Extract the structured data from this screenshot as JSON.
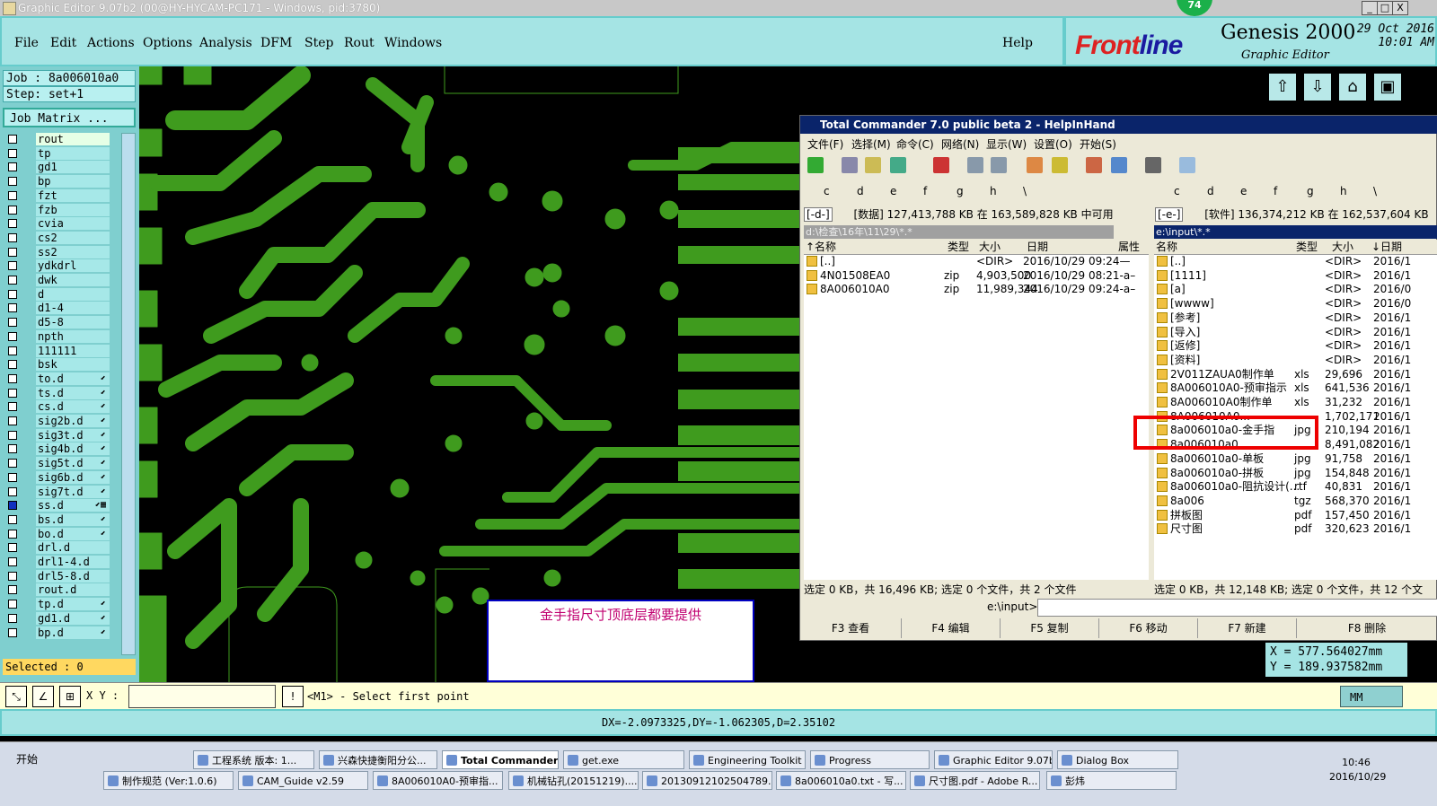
{
  "window": {
    "title": "Graphic Editor 9.07b2 (00@HY-HYCAM-PC171 - Windows, pid:3780)",
    "badge": "74",
    "controls": [
      "_",
      "□",
      "X"
    ]
  },
  "menubar": {
    "items": [
      "File",
      "Edit",
      "Actions",
      "Options",
      "Analysis",
      "DFM",
      "Step",
      "Rout",
      "Windows"
    ],
    "help": "Help"
  },
  "brand": {
    "logo_a": "Front",
    "logo_b": "line",
    "product": "Genesis 2000",
    "subtitle": "Graphic Editor",
    "date": "29 Oct 2016",
    "time": "10:01 AM"
  },
  "job": {
    "job_line": "Job : 8a006010a0",
    "step_line": "Step: set+1",
    "matrix_button": "Job Matrix ..."
  },
  "layers": [
    {
      "name": "rout",
      "mark": ""
    },
    {
      "name": "tp",
      "mark": ""
    },
    {
      "name": "gd1",
      "mark": ""
    },
    {
      "name": "bp",
      "mark": ""
    },
    {
      "name": "fzt",
      "mark": ""
    },
    {
      "name": "fzb",
      "mark": ""
    },
    {
      "name": "cvia",
      "mark": ""
    },
    {
      "name": "cs2",
      "mark": ""
    },
    {
      "name": "ss2",
      "mark": ""
    },
    {
      "name": "ydkdrl",
      "mark": ""
    },
    {
      "name": "dwk",
      "mark": ""
    },
    {
      "name": "d",
      "mark": ""
    },
    {
      "name": "d1-4",
      "mark": ""
    },
    {
      "name": "d5-8",
      "mark": ""
    },
    {
      "name": "npth",
      "mark": ""
    },
    {
      "name": "111111",
      "mark": ""
    },
    {
      "name": "bsk",
      "mark": ""
    },
    {
      "name": "to.d",
      "mark": "⬋"
    },
    {
      "name": "ts.d",
      "mark": "⬋"
    },
    {
      "name": "cs.d",
      "mark": "⬋"
    },
    {
      "name": "sig2b.d",
      "mark": "⬋"
    },
    {
      "name": "sig3t.d",
      "mark": "⬋"
    },
    {
      "name": "sig4b.d",
      "mark": "⬋"
    },
    {
      "name": "sig5t.d",
      "mark": "⬋"
    },
    {
      "name": "sig6b.d",
      "mark": "⬋"
    },
    {
      "name": "sig7t.d",
      "mark": "⬋"
    },
    {
      "name": "ss.d",
      "mark": "⬋▦"
    },
    {
      "name": "bs.d",
      "mark": "⬋"
    },
    {
      "name": "bo.d",
      "mark": "⬋"
    },
    {
      "name": "drl.d",
      "mark": ""
    },
    {
      "name": "drl1-4.d",
      "mark": ""
    },
    {
      "name": "drl5-8.d",
      "mark": ""
    },
    {
      "name": "rout.d",
      "mark": ""
    },
    {
      "name": "tp.d",
      "mark": "⬋"
    },
    {
      "name": "gd1.d",
      "mark": "⬋"
    },
    {
      "name": "bp.d",
      "mark": "⬋"
    }
  ],
  "selected_text": "Selected : 0",
  "note": "金手指尺寸顶底层都要提供",
  "coords": {
    "x": "X =  577.564027mm",
    "y": "Y =  189.937582mm"
  },
  "bottombar": {
    "xy_label": "X Y :",
    "xy_value": "",
    "prompt": "<M1> - Select first point",
    "unit": "MM"
  },
  "measure": "DX=-2.0973325,DY=-1.062305,D=2.35102",
  "tc": {
    "title": "Total Commander 7.0 public beta 2 - HelpInHand",
    "menu": [
      "文件(F)",
      "选择(M)",
      "命令(C)",
      "网络(N)",
      "显示(W)",
      "设置(O)",
      "开始(S)"
    ],
    "drives_left": [
      "c",
      "d",
      "e",
      "f",
      "g",
      "h",
      "\\"
    ],
    "drives_right": [
      "c",
      "d",
      "e",
      "f",
      "g",
      "h",
      "\\"
    ],
    "left": {
      "drive": "[-d-]",
      "info": "[数据]  127,413,788 KB 在 163,589,828 KB 中可用",
      "path": "d:\\检查\\16年\\11\\29\\*.*",
      "headers": [
        "↑名称",
        "类型",
        "大小",
        "日期",
        "属性"
      ],
      "files": [
        {
          "name": "[..]",
          "ext": "",
          "size": "<DIR>",
          "date": "2016/10/29 09:24—"
        },
        {
          "name": "4N01508EA0",
          "ext": "zip",
          "size": "4,903,500",
          "date": "2016/10/29 08:21-a–"
        },
        {
          "name": "8A006010A0",
          "ext": "zip",
          "size": "11,989,344",
          "date": "2016/10/29 09:24-a–"
        }
      ],
      "status": "选定 0 KB，共 16,496 KB; 选定 0 个文件，共 2 个文件"
    },
    "right": {
      "drive": "[-e-]",
      "info": "[软件]  136,374,212 KB 在 162,537,604 KB",
      "path": "e:\\input\\*.*",
      "headers": [
        "名称",
        "类型",
        "大小",
        "↓日期"
      ],
      "files": [
        {
          "name": "[..]",
          "ext": "",
          "size": "<DIR>",
          "date": "2016/1"
        },
        {
          "name": "[1111]",
          "ext": "",
          "size": "<DIR>",
          "date": "2016/1"
        },
        {
          "name": "[a]",
          "ext": "",
          "size": "<DIR>",
          "date": "2016/0"
        },
        {
          "name": "[wwww]",
          "ext": "",
          "size": "<DIR>",
          "date": "2016/0"
        },
        {
          "name": "[参考]",
          "ext": "",
          "size": "<DIR>",
          "date": "2016/1"
        },
        {
          "name": "[导入]",
          "ext": "",
          "size": "<DIR>",
          "date": "2016/1"
        },
        {
          "name": "[返修]",
          "ext": "",
          "size": "<DIR>",
          "date": "2016/1"
        },
        {
          "name": "[资料]",
          "ext": "",
          "size": "<DIR>",
          "date": "2016/1"
        },
        {
          "name": "2V011ZAUA0制作单",
          "ext": "xls",
          "size": "29,696",
          "date": "2016/1"
        },
        {
          "name": "8A006010A0-预审指示",
          "ext": "xls",
          "size": "641,536",
          "date": "2016/1"
        },
        {
          "name": "8A006010A0制作单",
          "ext": "xls",
          "size": "31,232",
          "date": "2016/1"
        },
        {
          "name": "8A006010A0...",
          "ext": "",
          "size": "1,702,171",
          "date": "2016/1"
        },
        {
          "name": "8a006010a0-金手指",
          "ext": "jpg",
          "size": "210,194",
          "date": "2016/1"
        },
        {
          "name": "8a006010a0...",
          "ext": "",
          "size": "8,491,082",
          "date": "2016/1"
        },
        {
          "name": "8a006010a0-单板",
          "ext": "jpg",
          "size": "91,758",
          "date": "2016/1"
        },
        {
          "name": "8a006010a0-拼板",
          "ext": "jpg",
          "size": "154,848",
          "date": "2016/1"
        },
        {
          "name": "8a006010a0-阻抗设计(...",
          "ext": "rtf",
          "size": "40,831",
          "date": "2016/1"
        },
        {
          "name": "8a006",
          "ext": "tgz",
          "size": "568,370",
          "date": "2016/1"
        },
        {
          "name": "拼板图",
          "ext": "pdf",
          "size": "157,450",
          "date": "2016/1"
        },
        {
          "name": "尺寸图",
          "ext": "pdf",
          "size": "320,623",
          "date": "2016/1"
        }
      ],
      "status": "选定 0 KB，共 12,148 KB; 选定 0 个文件，共 12 个文"
    },
    "cmd_label": "e:\\input>",
    "fkeys": [
      "F3 查看",
      "F4 编辑",
      "F5 复制",
      "F6 移动",
      "F7 新建",
      "F8 删除"
    ]
  },
  "taskbar": {
    "start": "开始",
    "row1": [
      "工程系统  版本: 1...",
      "兴森快捷衡阳分公...",
      "Total Commander...",
      "get.exe",
      "Engineering Toolkit 9...",
      "Progress",
      "Graphic Editor 9.07b...",
      "Dialog Box"
    ],
    "row2": [
      "制作规范 (Ver:1.0.6)",
      "CAM_Guide v2.59",
      "8A006010A0-预审指...",
      "机械钻孔(20151219)....",
      "20130912102504789.r...",
      "8a006010a0.txt - 写...",
      "尺寸图.pdf - Adobe R...",
      "彭炜"
    ],
    "time": "10:46",
    "date": "2016/10/29"
  }
}
